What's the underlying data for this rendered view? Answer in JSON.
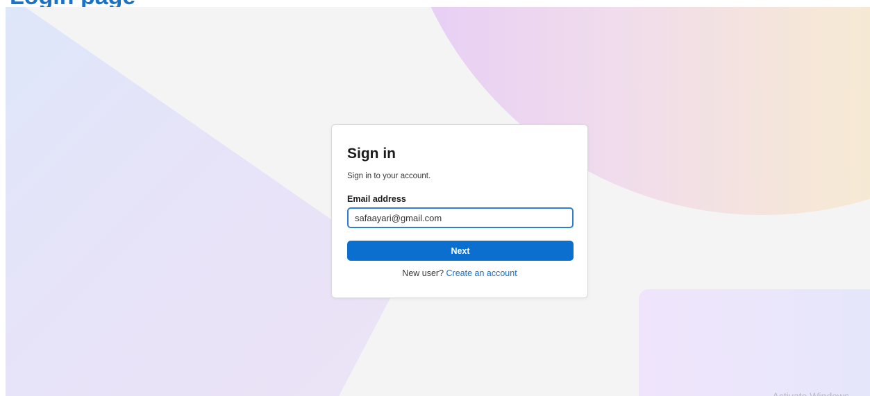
{
  "page": {
    "heading": "Login page"
  },
  "signin": {
    "title": "Sign in",
    "subtitle": "Sign in to your account.",
    "email_label": "Email address",
    "email_value": "safaayari@gmail.com",
    "next_label": "Next",
    "new_user_text": "New user?",
    "create_account_label": "Create an account"
  },
  "watermark": {
    "text": "Activate Windows"
  },
  "colors": {
    "primary": "#0b6fd0",
    "link": "#1a6fc4",
    "heading": "#1a73c6",
    "background": "#f4f4f4"
  }
}
